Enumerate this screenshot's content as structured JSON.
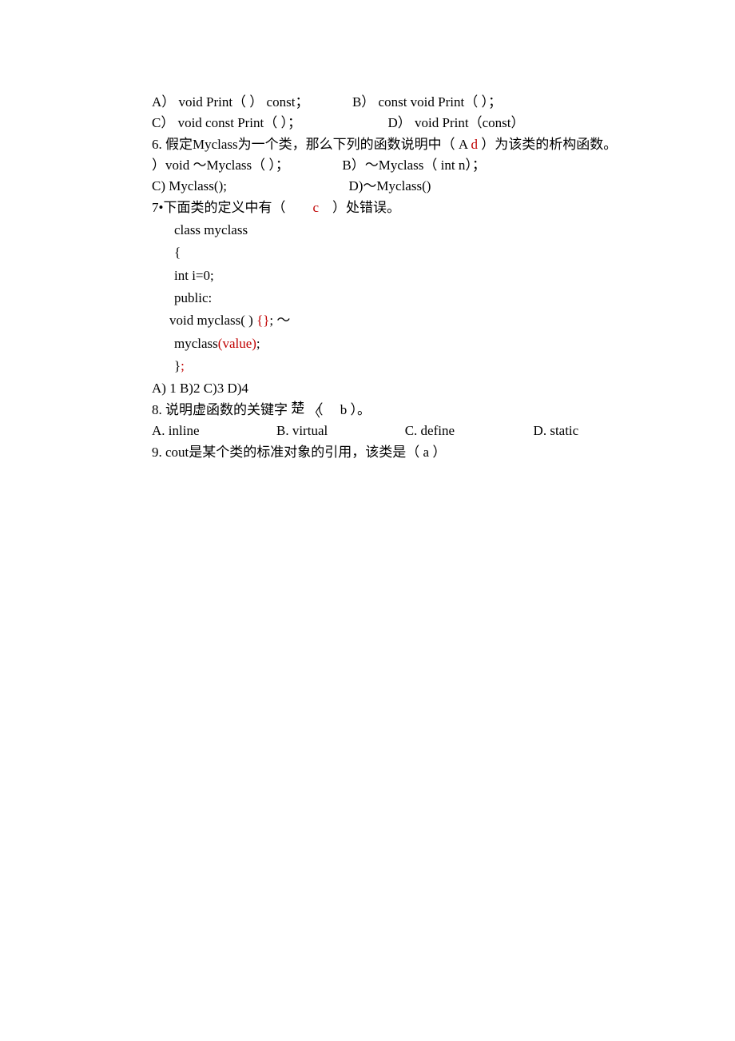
{
  "l1_a": "A）   void Print（ ） const；",
  "l1_b": "B） const void Print（ ）；",
  "l2_c": "C） void const Print（ ）；",
  "l2_d": "D） void Print（const）",
  "q6_pre": "6. 假定Myclass为一个类，那么下列的函数说明中（ A  ",
  "q6_red": "d",
  "q6_post": "     ）为该类的析构函数。",
  "q6_opt1a": " ）void 〜Myclass（ ）；",
  "q6_opt1b": "B）〜Myclass（ int n）；",
  "q6_opt2a": "C) Myclass();",
  "q6_opt2b": "D)〜Myclass()",
  "q7_pre": "7•下面类的定义中有（　　",
  "q7_red": "c",
  "q7_post": "　）处错误。",
  "code1": "class myclass",
  "code2": "{",
  "code3": "int i=0;",
  "code4": "public:",
  "code5a": "void myclass( )",
  "code5b": " {}",
  "code5c": "; 〜",
  "code6a": "myclass",
  "code6b": "(value)",
  "code6c": ";",
  "code7a": "}",
  "code7b": ";",
  "q7_opts": "A) 1        B)2        C)3        D)4",
  "q8_a": "8. 说明虚函数的关键字  ",
  "q8_b": "楚",
  "q8_c": "（　 b ）。",
  "q8_opts_a": "A. inline",
  "q8_opts_b": "B. virtual",
  "q8_opts_c": "C. define",
  "q8_opts_d": "D. static",
  "q9": "9.   cout是某个类的标准对象的引用，该类是（ a ）"
}
